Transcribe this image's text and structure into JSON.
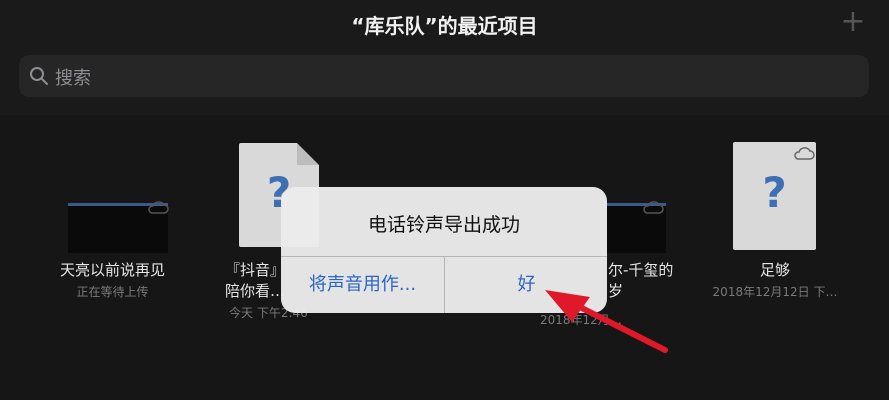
{
  "header": {
    "title": "“库乐队”的最近项目",
    "add_icon": "plus-icon"
  },
  "search": {
    "placeholder": "搜索",
    "icon": "search-icon"
  },
  "items": [
    {
      "name": "天亮以前说再见",
      "sub": "正在等待上传",
      "thumb": "video",
      "cloud": true
    },
    {
      "name": "『抖音』",
      "name2": "陪你看…",
      "sub": "今天 下午2:46",
      "thumb": "document"
    },
    {
      "name": "尔-千玺的",
      "name2": "岁",
      "sub": "2018年12月…",
      "thumb": "video",
      "cloud": true
    },
    {
      "name": "足够",
      "sub": "2018年12月12日 下…",
      "thumb": "document",
      "cloud": true
    }
  ],
  "alert": {
    "message": "电话铃声导出成功",
    "secondary_button": "将声音用作...",
    "primary_button": "好"
  },
  "colors": {
    "accent": "#2b66c7",
    "annotation": "#e0192a"
  }
}
